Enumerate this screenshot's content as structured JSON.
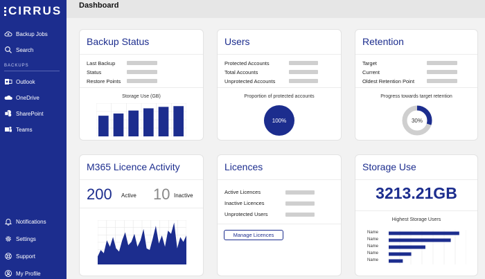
{
  "app": {
    "logo": "CIRRUS",
    "page_title": "Dashboard"
  },
  "sidebar": {
    "top_items": [
      {
        "label": "Backup Jobs",
        "icon": "cloud-upload-icon"
      },
      {
        "label": "Search",
        "icon": "search-icon"
      }
    ],
    "section_label": "BACKUPS",
    "backup_items": [
      {
        "label": "Outlook",
        "icon": "outlook-icon"
      },
      {
        "label": "OneDrive",
        "icon": "onedrive-icon"
      },
      {
        "label": "SharePoint",
        "icon": "sharepoint-icon"
      },
      {
        "label": "Teams",
        "icon": "teams-icon"
      }
    ],
    "bottom_items": [
      {
        "label": "Notifications",
        "icon": "bell-icon"
      },
      {
        "label": "Settings",
        "icon": "gear-icon"
      },
      {
        "label": "Support",
        "icon": "lifebuoy-icon"
      },
      {
        "label": "My Profile",
        "icon": "user-icon"
      }
    ]
  },
  "backup_status": {
    "title": "Backup Status",
    "rows": [
      "Last Backup",
      "Status",
      "Restore Points"
    ],
    "chart_title": "Storage Use (GB)"
  },
  "users": {
    "title": "Users",
    "rows": [
      "Protected Accounts",
      "Total Accounts",
      "Unprotected Accounts"
    ],
    "chart_title": "Proportion of protected accounts",
    "donut_value": "100%"
  },
  "retention": {
    "title": "Retention",
    "rows": [
      "Target",
      "Current",
      "Oldest Retention Point"
    ],
    "chart_title": "Progress towards target retention",
    "donut_value": "30%"
  },
  "licence_activity": {
    "title": "M365 Licence Activity",
    "active_count": "200",
    "active_label": "Active",
    "inactive_count": "10",
    "inactive_label": "Inactive"
  },
  "licences": {
    "title": "Licences",
    "rows": [
      "Active Licences",
      "Inactive Licences",
      "Unprotected Users"
    ],
    "button_label": "Manage Licences"
  },
  "storage_use": {
    "title": "Storage Use",
    "total": "3213.21GB",
    "chart_title": "Highest Storage Users"
  },
  "colors": {
    "brand": "#1c2d8e",
    "placeholder": "#cfcfcf",
    "track": "#cfcfcf"
  },
  "chart_data": [
    {
      "type": "bar",
      "title": "Storage Use (GB)",
      "categories": [
        "",
        "",
        "",
        "",
        "",
        ""
      ],
      "values": [
        28,
        31,
        35,
        38,
        40,
        41
      ],
      "grid": true
    },
    {
      "type": "pie",
      "title": "Proportion of protected accounts",
      "values": [
        100
      ],
      "label": "100%"
    },
    {
      "type": "pie",
      "title": "Progress towards target retention",
      "values": [
        30,
        70
      ],
      "label": "30%"
    },
    {
      "type": "area",
      "title": "",
      "values": [
        10,
        18,
        14,
        30,
        22,
        34,
        20,
        16,
        30,
        40,
        24,
        28,
        38,
        22,
        30,
        44,
        20,
        18,
        32,
        48,
        26,
        36,
        22,
        42,
        38,
        52,
        20,
        34,
        28,
        36
      ],
      "grid": true
    },
    {
      "type": "bar",
      "orientation": "horizontal",
      "title": "Highest Storage Users",
      "categories": [
        "Name",
        "Name",
        "Name",
        "Name",
        "Name"
      ],
      "values": [
        100,
        88,
        52,
        32,
        20
      ],
      "grid": true
    }
  ]
}
